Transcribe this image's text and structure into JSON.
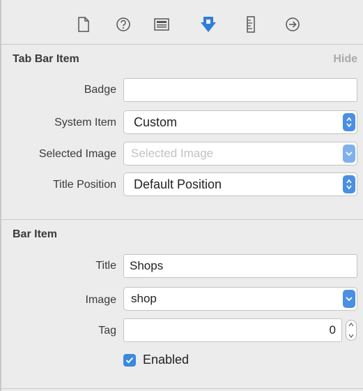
{
  "toolbar": {
    "icons": [
      "file-icon",
      "help-icon",
      "identity-icon",
      "attributes-icon",
      "size-icon",
      "connections-icon"
    ],
    "accent": "#2f7fd6"
  },
  "tab_bar_item": {
    "title": "Tab Bar Item",
    "hide_label": "Hide",
    "badge": {
      "label": "Badge",
      "value": ""
    },
    "system_item": {
      "label": "System Item",
      "value": "Custom"
    },
    "selected_image": {
      "label": "Selected Image",
      "placeholder": "Selected Image"
    },
    "title_position": {
      "label": "Title Position",
      "value": "Default Position"
    }
  },
  "bar_item": {
    "title": "Bar Item",
    "title_field": {
      "label": "Title",
      "value": "Shops"
    },
    "image": {
      "label": "Image",
      "value": "shop"
    },
    "tag": {
      "label": "Tag",
      "value": "0"
    },
    "enabled": {
      "label": "Enabled",
      "checked": true
    }
  }
}
